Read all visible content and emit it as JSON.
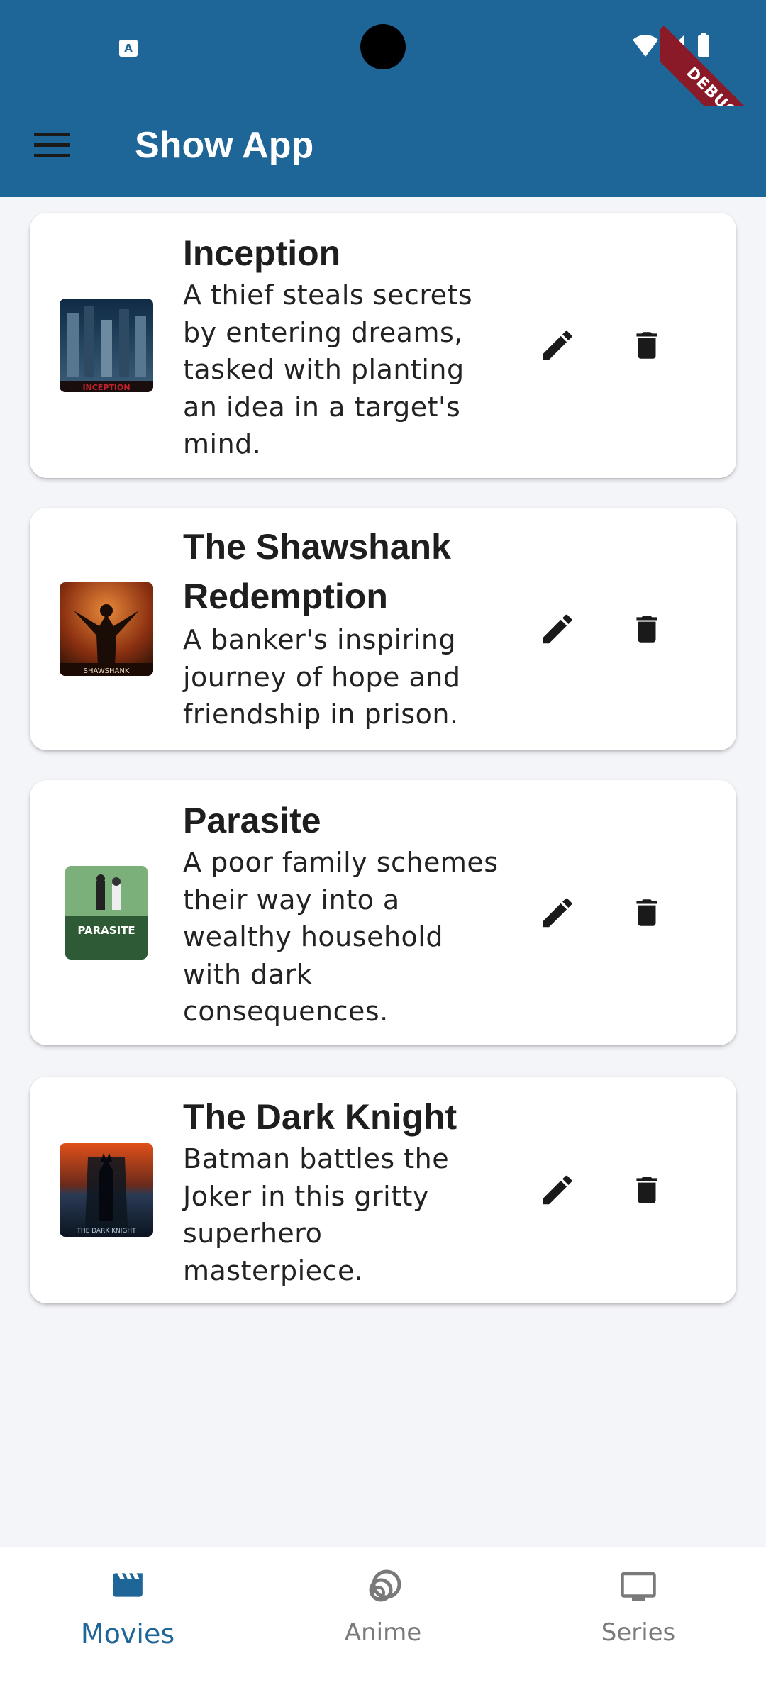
{
  "app": {
    "title": "Show App",
    "debug_label": "DEBUG"
  },
  "status": {
    "notification_glyph": "A"
  },
  "movies": [
    {
      "title": "Inception",
      "description": "A thief steals secrets by entering dreams, tasked with planting an idea in a target's mind.",
      "poster_text": "INCEPTION",
      "poster_colors": [
        "#0f2a44",
        "#3c5f7a",
        "#a01a1a"
      ]
    },
    {
      "title": "The Shawshank Redemption",
      "description": "A banker's inspiring journey of hope and friendship in prison.",
      "poster_text": "SHAWSHANK",
      "poster_colors": [
        "#7a2a0d",
        "#d06a2a",
        "#2a1208"
      ]
    },
    {
      "title": "Parasite",
      "description": "A poor family schemes their way into a wealthy household with dark consequences.",
      "poster_text": "PARASITE",
      "poster_colors": [
        "#2f5a36",
        "#7cb07a",
        "#e8efe6"
      ]
    },
    {
      "title": "The Dark Knight",
      "description": "Batman battles the Joker in this gritty superhero masterpiece.",
      "poster_text": "THE DARK KNIGHT",
      "poster_colors": [
        "#d8400f",
        "#2a3b55",
        "#0b1420"
      ]
    }
  ],
  "bottom_nav": [
    {
      "label": "Movies",
      "icon": "movie-clapper-icon",
      "active": true
    },
    {
      "label": "Anime",
      "icon": "anime-rings-icon",
      "active": false
    },
    {
      "label": "Series",
      "icon": "tv-icon",
      "active": false
    }
  ],
  "colors": {
    "primary": "#1e6598",
    "background": "#f4f5f9",
    "inactive": "#7a7a7a"
  }
}
